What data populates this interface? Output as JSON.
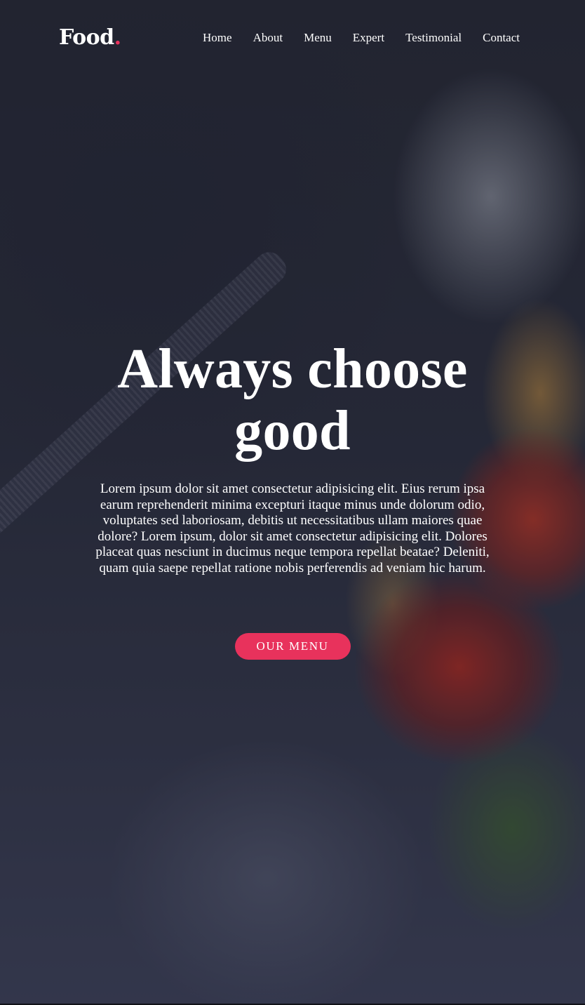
{
  "brand": {
    "name": "Food",
    "dot": ".",
    "accent_color": "#e8325c"
  },
  "nav": {
    "items": [
      {
        "label": "Home"
      },
      {
        "label": "About"
      },
      {
        "label": "Menu"
      },
      {
        "label": "Expert"
      },
      {
        "label": "Testimonial"
      },
      {
        "label": "Contact"
      }
    ]
  },
  "hero": {
    "headline": "Always choose good",
    "lead": "Lorem ipsum dolor sit amet consectetur adipisicing elit. Eius rerum ipsa earum reprehenderit minima excepturi itaque minus unde dolorum odio, voluptates sed laboriosam, debitis ut necessitatibus ullam maiores quae dolore? Lorem ipsum, dolor sit amet consectetur adipisicing elit. Dolores placeat quas nesciunt in ducimus neque tempora repellat beatae? Deleniti, quam quia saepe repellat ratione nobis perferendis ad veniam hic harum.",
    "cta_label": "Our Menu"
  }
}
